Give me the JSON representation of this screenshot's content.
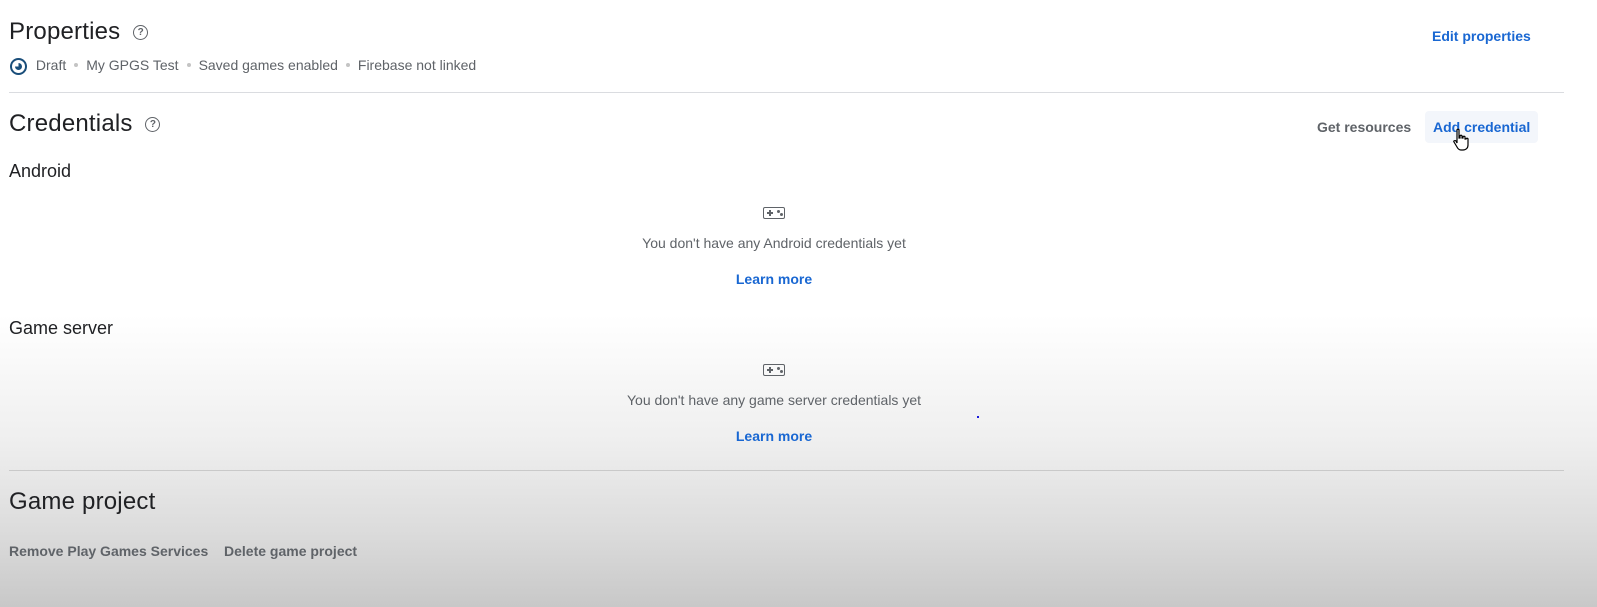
{
  "properties": {
    "title": "Properties",
    "help_icon": "help-circle-icon",
    "edit_label": "Edit properties",
    "meta": [
      "Draft",
      "My GPGS Test",
      "Saved games enabled",
      "Firebase not linked"
    ]
  },
  "credentials": {
    "title": "Credentials",
    "get_resources_label": "Get resources",
    "add_credential_label": "Add credential",
    "android": {
      "heading": "Android",
      "icon": "gamepad-icon",
      "empty_text": "You don't have any Android credentials yet",
      "learn_more": "Learn more"
    },
    "game_server": {
      "heading": "Game server",
      "icon": "gamepad-icon",
      "empty_text": "You don't have any game server credentials yet",
      "learn_more": "Learn more"
    }
  },
  "game_project": {
    "title": "Game project",
    "remove_label": "Remove Play Games Services",
    "delete_label": "Delete game project"
  },
  "colors": {
    "link": "#1967d2",
    "text": "#202124",
    "secondary": "#5f6368",
    "divider": "#dadce0"
  }
}
